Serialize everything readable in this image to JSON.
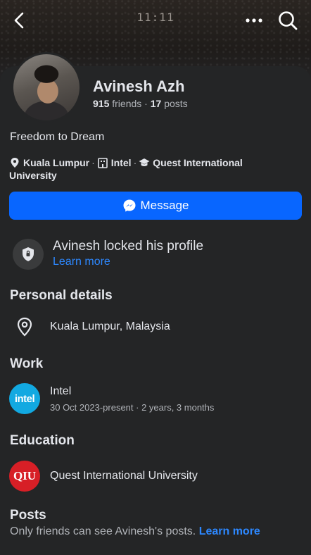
{
  "status_bar": {
    "time": "11:11"
  },
  "nav": {
    "back_icon": "chevron-left-icon",
    "more_icon": "ellipsis-icon",
    "search_icon": "search-icon"
  },
  "profile": {
    "name": "Avinesh Azh",
    "friends_count": "915",
    "friends_label": "friends",
    "separator": "·",
    "posts_count": "17",
    "posts_label": "posts",
    "bio": "Freedom to Dream",
    "meta": {
      "location": "Kuala Lumpur",
      "workplace": "Intel",
      "school": "Quest International University"
    }
  },
  "message_button": {
    "label": "Message",
    "icon": "messenger-icon",
    "color": "#0866ff"
  },
  "locked_notice": {
    "text": "Avinesh locked his profile",
    "link": "Learn more",
    "icon": "shield-lock-icon"
  },
  "personal_details": {
    "heading": "Personal details",
    "location": "Kuala Lumpur, Malaysia",
    "icon": "location-pin-icon"
  },
  "work": {
    "heading": "Work",
    "logo_text": "intel",
    "company": "Intel",
    "dates": "30 Oct 2023-present · 2 years, 3 months",
    "logo_color": "#12a9e1"
  },
  "education": {
    "heading": "Education",
    "logo_text": "QIU",
    "school": "Quest International University",
    "logo_color": "#d71f26"
  },
  "posts": {
    "heading": "Posts",
    "note": "Only friends can see Avinesh's posts.",
    "link": "Learn more"
  },
  "colors": {
    "background": "#242526",
    "accent": "#2d88ff",
    "text": "#e4e6eb",
    "secondary": "#b0b3b8"
  }
}
